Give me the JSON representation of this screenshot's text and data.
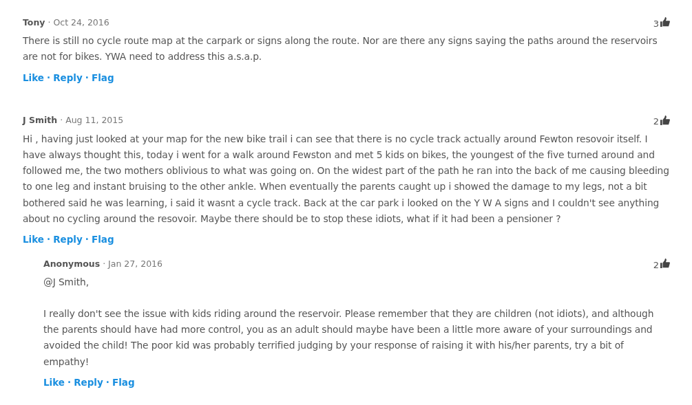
{
  "comments": [
    {
      "author": "Tony",
      "date": "Oct 24, 2016",
      "likes": "3",
      "paragraphs": [
        "There is still no cycle route map at the carpark or signs along the route. Nor are there any signs saying the paths around the reservoirs are not for bikes. YWA need to address this a.s.a.p."
      ],
      "actions": [
        "Like",
        "Reply",
        "Flag"
      ]
    },
    {
      "author": "J Smith",
      "date": "Aug 11, 2015",
      "likes": "2",
      "paragraphs": [
        "Hi , having just looked at your map for the new bike trail i can see that there is no cycle track actually around Fewton resovoir itself. I have always thought this, today i went for a walk around Fewston and met 5 kids on bikes, the youngest of the five turned around and followed me, the two mothers oblivious to what was going on. On the widest part of the path he ran into the back of me causing bleeding to one leg and instant bruising to the other ankle. When eventually the parents caught up i showed the damage to my legs, not a bit bothered said he was learning, i said it wasnt a cycle track. Back at the car park i looked on the Y W A signs and I couldn't see anything about no cycling around the resovoir. Maybe there should be to stop these idiots, what if it had been a pensioner ?"
      ],
      "actions": [
        "Like",
        "Reply",
        "Flag"
      ],
      "children": [
        {
          "author": "Anonymous",
          "date": "Jan 27, 2016",
          "likes": "2",
          "paragraphs": [
            "@J Smith,",
            "I really don't see the issue with kids riding around the reservoir. Please remember that they are children (not idiots), and although the parents should have had more control, you as an adult should maybe have been a little more aware of your surroundings and avoided the child! The poor kid was probably terrified judging by your response of raising it with his/her parents, try a bit of empathy!"
          ],
          "actions": [
            "Like",
            "Reply",
            "Flag"
          ]
        }
      ]
    }
  ],
  "separator": "·"
}
